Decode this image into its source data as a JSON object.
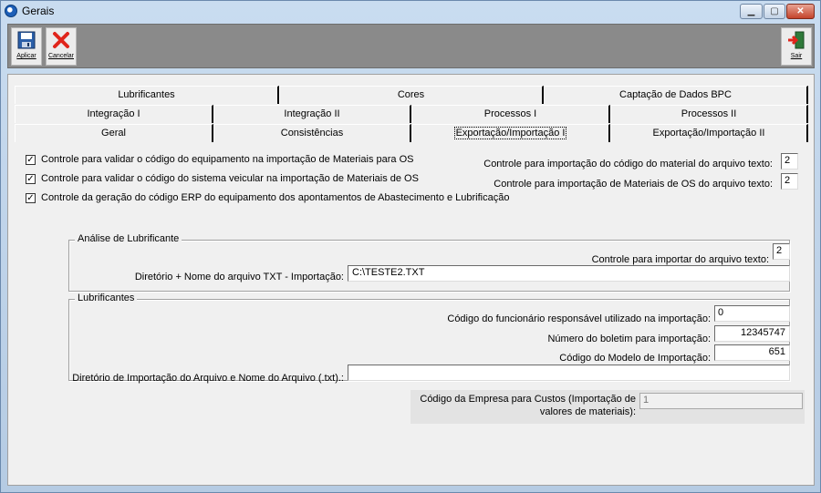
{
  "window": {
    "title": "Gerais",
    "minimize": "▁",
    "maximize": "▢",
    "close": "✕"
  },
  "toolbar": {
    "apply_label": "Aplicar",
    "cancel_label": "Cancelar",
    "exit_label": "Sair"
  },
  "tabs": {
    "row1": [
      "Lubrificantes",
      "Cores",
      "Captação de Dados BPC"
    ],
    "row2": [
      "Integração I",
      "Integração II",
      "Processos I",
      "Processos II"
    ],
    "row3": [
      "Geral",
      "Consistências",
      "Exportação/Importação I",
      "Exportação/Importação II"
    ]
  },
  "checks": [
    {
      "label": "Controle para validar o código do equipamento na importação de Materiais para OS",
      "checked": "✓"
    },
    {
      "label": "Controle para validar o código do sistema veicular na importação de Materiais de OS",
      "checked": "✓"
    },
    {
      "label": "Controle da geração do código ERP do equipamento dos apontamentos de Abastecimento e Lubrificação",
      "checked": "✓"
    }
  ],
  "right_fields": {
    "material_code_label": "Controle para importação do código do material do arquivo texto:",
    "material_code_value": "2",
    "os_materials_label": "Controle para importação de Materiais de OS do arquivo texto:",
    "os_materials_value": "2"
  },
  "lub_analysis": {
    "title": "Análise de Lubrificante",
    "control_label": "Controle para importar do arquivo texto:",
    "control_value": "2",
    "dir_label": "Diretório + Nome do arquivo TXT - Importação:",
    "dir_value": "C:\\TESTE2.TXT"
  },
  "lubricants": {
    "title": "Lubrificantes",
    "employee_label": "Código do funcionário responsável utilizado na importação:",
    "employee_value": "0",
    "bulletin_label": "Número do boletim para importação:",
    "bulletin_value": "12345747",
    "model_label": "Código do Modelo de Importação:",
    "model_value": "651",
    "dir_label": "Diretório de Importação do Arquivo e Nome do Arquivo (.txt).:",
    "dir_value": ""
  },
  "company": {
    "label_line1": "Código da Empresa para Custos (Importação de",
    "label_line2": "valores de materiais):",
    "value": "1"
  }
}
